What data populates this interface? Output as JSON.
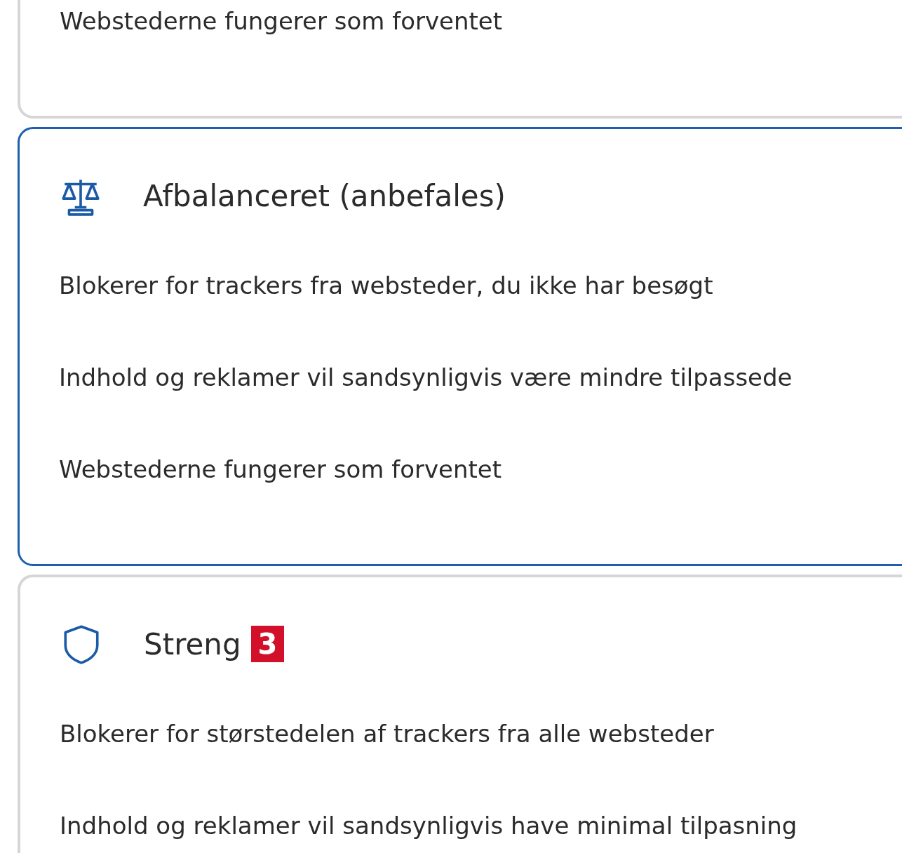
{
  "cards": [
    {
      "selected": false,
      "lines": [
        "Webstederne fungerer som forventet"
      ]
    },
    {
      "kind": "balance",
      "title": "Afbalanceret (anbefales)",
      "selected": true,
      "lines": [
        "Blokerer for trackers fra websteder, du ikke har besøgt",
        "Indhold og reklamer vil sandsynligvis være mindre tilpassede",
        "Webstederne fungerer som forventet"
      ]
    },
    {
      "kind": "shield",
      "title": "Streng",
      "badge": "3",
      "selected": false,
      "lines": [
        "Blokerer for størstedelen af trackers fra alle websteder",
        "Indhold og reklamer vil sandsynligvis have minimal tilpasning"
      ]
    }
  ]
}
